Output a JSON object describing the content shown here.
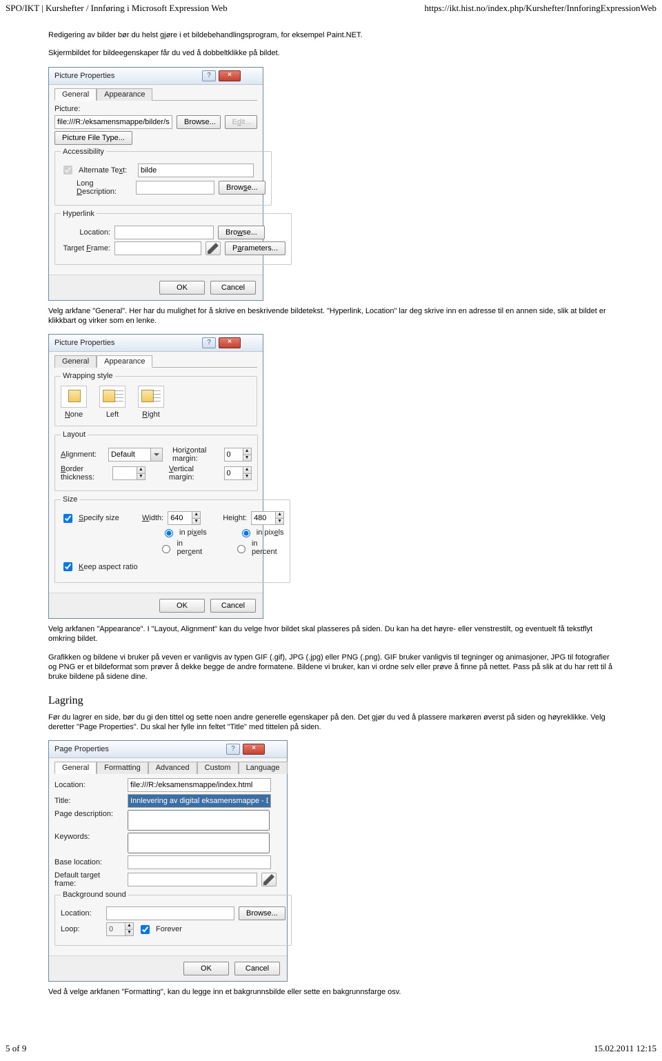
{
  "header": {
    "left": "SPO/IKT | Kurshefter / Innføring i Microsoft Expression Web",
    "right": "https://ikt.hist.no/index.php/Kurshefter/InnforingExpressionWeb"
  },
  "para1": "Redigering av bilder bør du helst gjøre i et bildebehandlingsprogram, for eksempel Paint.NET.",
  "para2": "Skjermbildet for bildeegenskaper får du ved å dobbeltklikke på bildet.",
  "dlg1": {
    "title": "Picture Properties",
    "tab_general": "General",
    "tab_appearance": "Appearance",
    "grp_picture": "Picture:",
    "picture_path": "file:///R:/eksamensmappe/bilder/sommer.jpg",
    "browse": "Browse...",
    "edit": "Edit...",
    "picture_file_type": "Picture File Type...",
    "grp_access": "Accessibility",
    "alt_label": "Alternate Text:",
    "alt_value": "bilde",
    "longdesc_label": "Long Description:",
    "grp_hyper": "Hyperlink",
    "location_label": "Location:",
    "target_label": "Target Frame:",
    "parameters": "Parameters...",
    "ok": "OK",
    "cancel": "Cancel"
  },
  "para3": "Velg arkfane \"General\". Her har du mulighet for å skrive en beskrivende bildetekst. \"Hyperlink, Location\" lar deg skrive inn en adresse til en annen side, slik at bildet er klikkbart og virker som en lenke.",
  "dlg2": {
    "title": "Picture Properties",
    "tab_general": "General",
    "tab_appearance": "Appearance",
    "grp_wrap": "Wrapping style",
    "wrap_none": "None",
    "wrap_left": "Left",
    "wrap_right": "Right",
    "grp_layout": "Layout",
    "alignment_label": "Alignment:",
    "alignment_value": "Default",
    "hmargin_label": "Horizontal margin:",
    "hmargin_value": "0",
    "border_label": "Border thickness:",
    "vmargin_label": "Vertical margin:",
    "vmargin_value": "0",
    "grp_size": "Size",
    "specify_size": "Specify size",
    "width_label": "Width:",
    "width_value": "640",
    "height_label": "Height:",
    "height_value": "480",
    "in_pixels": "in pixels",
    "in_percent": "in percent",
    "keep_aspect": "Keep aspect ratio",
    "ok": "OK",
    "cancel": "Cancel"
  },
  "para4": "Velg arkfanen \"Appearance\". I \"Layout, Alignment\" kan du velge hvor bildet skal plasseres på siden. Du kan ha det høyre- eller venstrestilt, og eventuelt få tekstflyt omkring bildet.",
  "para5": "Grafikken og bildene vi bruker på veven er vanligvis av typen GIF (.gif), JPG (.jpg) eller PNG (.png). GIF bruker vanligvis til tegninger og animasjoner, JPG til fotografier og PNG er et bildeformat som prøver å dekke begge de andre formatene. Bildene vi bruker, kan vi ordne selv eller prøve å finne på nettet. Pass på slik at du har rett til å bruke bildene på sidene dine.",
  "section_lagring": "Lagring",
  "para6": "Før du lagrer en side, bør du gi den tittel og sette noen andre generelle egenskaper på den. Det gjør du ved å plassere markøren øverst på siden og høyreklikke. Velg deretter \"Page Properties\". Du skal her fylle inn feltet \"Title\" med tittelen på siden.",
  "dlg3": {
    "title": "Page Properties",
    "tab_general": "General",
    "tab_formatting": "Formatting",
    "tab_advanced": "Advanced",
    "tab_custom": "Custom",
    "tab_language": "Language",
    "location_label": "Location:",
    "location_value": "file:///R:/eksamensmappe/index.html",
    "title_label": "Title:",
    "title_value": "Innlevering av digital eksamensmappe - Ditt Navn",
    "pagedesc_label": "Page description:",
    "keywords_label": "Keywords:",
    "baseloc_label": "Base location:",
    "target_label": "Default target frame:",
    "grp_bgsound": "Background sound",
    "bgsound_loc": "Location:",
    "browse": "Browse...",
    "loop_label": "Loop:",
    "loop_value": "0",
    "forever": "Forever",
    "ok": "OK",
    "cancel": "Cancel"
  },
  "para7": "Ved å velge arkfanen \"Formatting\", kan du legge inn et bakgrunnsbilde eller sette en bakgrunnsfarge osv.",
  "footer": {
    "left": "5 of 9",
    "right": "15.02.2011 12:15"
  }
}
